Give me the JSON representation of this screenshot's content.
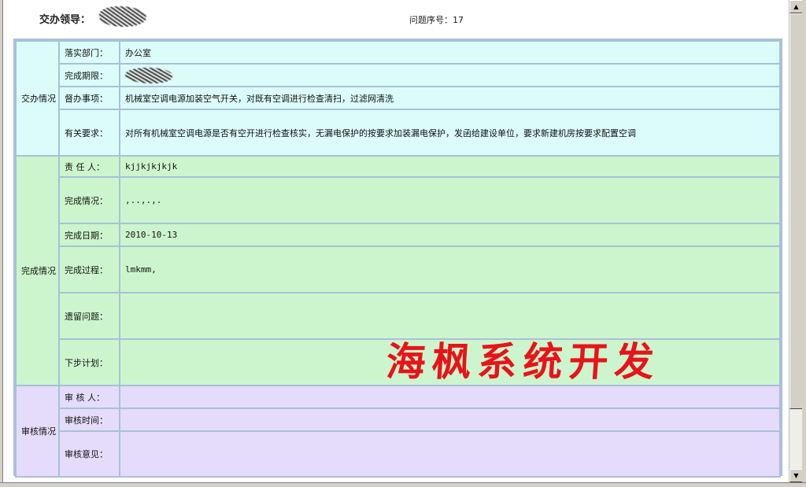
{
  "header": {
    "leader_label": "交办领导：",
    "serial_label": "问题序号：17"
  },
  "sections": {
    "assign": {
      "title": "交办情况",
      "rows": [
        {
          "label": "落实部门：",
          "value": "办公室"
        },
        {
          "label": "完成期限：",
          "value": ""
        },
        {
          "label": "督办事项：",
          "value": "机械室空调电源加装空气开关，对既有空调进行检查清扫，过滤网清洗"
        },
        {
          "label": "有关要求：",
          "value": "对所有机械室空调电源是否有空开进行检查核实，无漏电保护的按要求加装漏电保护，发函给建设单位，要求新建机房按要求配置空调"
        }
      ]
    },
    "complete": {
      "title": "完成情况",
      "rows": [
        {
          "label": "责 任 人：",
          "value": "kjjkjkjkjk"
        },
        {
          "label": "完成情况：",
          "value": ",..,.,."
        },
        {
          "label": "完成日期：",
          "value": "2010-10-13"
        },
        {
          "label": "完成过程：",
          "value": "lmkmm,"
        },
        {
          "label": "遗留问题：",
          "value": ""
        },
        {
          "label": "下步计划：",
          "value": ""
        }
      ]
    },
    "review": {
      "title": "审核情况",
      "rows": [
        {
          "label": "审 核 人：",
          "value": ""
        },
        {
          "label": "审核时间：",
          "value": ""
        },
        {
          "label": "审核意见：",
          "value": ""
        }
      ]
    }
  },
  "watermark": "海枫系统开发",
  "scrollbar": {
    "up_icon": "arrow-up",
    "down_icon": "arrow-down"
  }
}
